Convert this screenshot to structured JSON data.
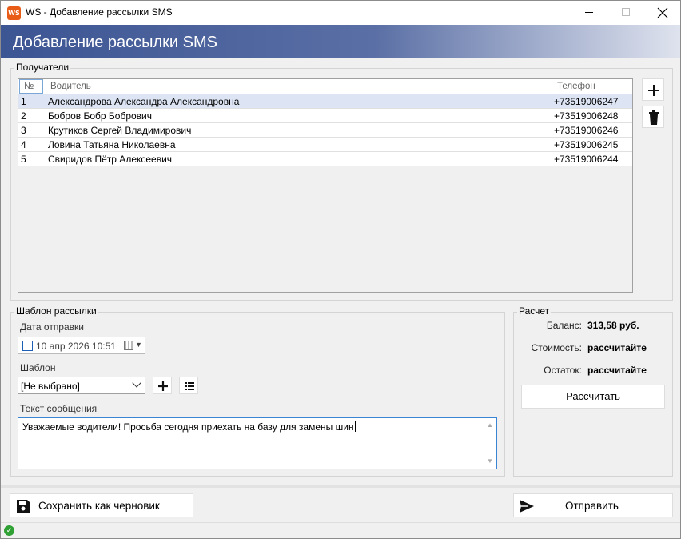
{
  "window": {
    "logo_text": "WS",
    "title": "WS - Добавление рассылки SMS"
  },
  "banner": {
    "title": "Добавление рассылки SMS"
  },
  "recipients": {
    "group_label": "Получатели",
    "columns": [
      "№",
      "Водитель",
      "Телефон"
    ],
    "rows": [
      {
        "num": "1",
        "name": "Александрова Александра Александровна",
        "phone": "+73519006247"
      },
      {
        "num": "2",
        "name": "Бобров Бобр Бобрович",
        "phone": "+73519006248"
      },
      {
        "num": "3",
        "name": "Крутиков Сергей Владимирович",
        "phone": "+73519006246"
      },
      {
        "num": "4",
        "name": "Ловина Татьяна Николаевна",
        "phone": "+73519006245"
      },
      {
        "num": "5",
        "name": "Свиридов Пётр Алексеевич",
        "phone": "+73519006244"
      }
    ],
    "selected_row": 0
  },
  "template": {
    "group_label": "Шаблон рассылки",
    "date_caption": "Дата отправки",
    "date_value": "10  апр  2026 10:51",
    "template_caption": "Шаблон",
    "template_value": "[Не выбрано]",
    "message_caption": "Текст сообщения",
    "message_text": "Уважаемые водители! Просьба сегодня приехать на базу для замены шин"
  },
  "calc": {
    "group_label": "Расчет",
    "balance_label": "Баланс:",
    "balance_value": "313,58 руб.",
    "cost_label": "Стоимость:",
    "cost_value": "рассчитайте",
    "remainder_label": "Остаток:",
    "remainder_value": "рассчитайте",
    "calc_button": "Рассчитать"
  },
  "actions": {
    "save_draft": "Сохранить как черновик",
    "send": "Отправить"
  },
  "colors": {
    "banner_start": "#3c5593",
    "selected_row": "#dde5f4",
    "focus_border": "#3a84d6",
    "status_ok": "#2fa033"
  }
}
